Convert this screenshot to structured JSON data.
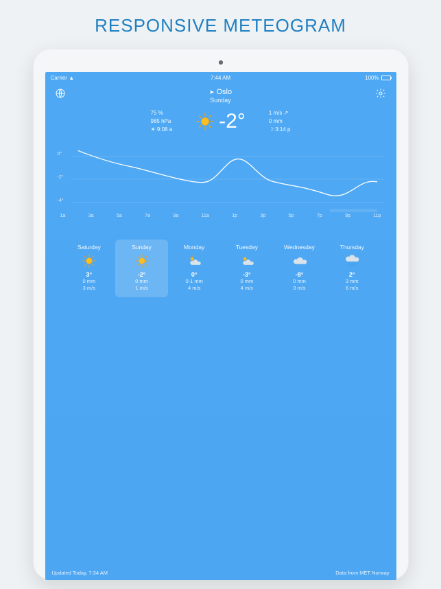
{
  "page_title": "RESPONSIVE METEOGRAM",
  "statusbar": {
    "carrier": "Carrier",
    "time": "7:44 AM",
    "battery": "100%"
  },
  "header": {
    "city": "Oslo",
    "day": "Sunday"
  },
  "current": {
    "left": {
      "humidity": "75 %",
      "pressure": "985 hPa",
      "sunrise": "☀ 9:08 a"
    },
    "temp": "-2°",
    "right": {
      "wind": "1 m/s ↗",
      "precip": "0 mm",
      "sunset": "☽ 3:14 p"
    }
  },
  "chart_data": {
    "type": "line",
    "xlabel": "",
    "ylabel": "",
    "ylim": [
      -5,
      1
    ],
    "x_ticks": [
      "1a",
      "3a",
      "5a",
      "7a",
      "9a",
      "11a",
      "1p",
      "3p",
      "5p",
      "7p",
      "9p",
      "11p"
    ],
    "y_ticks": [
      "0°",
      "-2°",
      "-4°"
    ],
    "series": [
      {
        "name": "temperature",
        "x": [
          0,
          1,
          2,
          3,
          4,
          5,
          6,
          7,
          8,
          9,
          10,
          11
        ],
        "values": [
          0.5,
          -0.5,
          -1.2,
          -1.8,
          -2.5,
          -2.5,
          -0.8,
          -2.0,
          -2.5,
          -2.8,
          -3.5,
          -2.4
        ]
      }
    ],
    "hour_icons": [
      "moon",
      "moon",
      "moon",
      "moon",
      "moon",
      "sun",
      "sun",
      "sun",
      "partly",
      "cloud",
      "cloud",
      "cloud"
    ]
  },
  "forecast": [
    {
      "day": "Saturday",
      "icon": "sun",
      "temp": "3°",
      "precip": "0 mm",
      "wind": "3 m/s",
      "selected": false
    },
    {
      "day": "Sunday",
      "icon": "sun",
      "temp": "-2°",
      "precip": "0 mm",
      "wind": "1 m/s",
      "selected": true
    },
    {
      "day": "Monday",
      "icon": "partly",
      "temp": "0°",
      "precip": "0-1 mm",
      "wind": "4 m/s",
      "selected": false
    },
    {
      "day": "Tuesday",
      "icon": "partly",
      "temp": "-3°",
      "precip": "0 mm",
      "wind": "4 m/s",
      "selected": false
    },
    {
      "day": "Wednesday",
      "icon": "cloud",
      "temp": "-8°",
      "precip": "0 mm",
      "wind": "3 m/s",
      "selected": false
    },
    {
      "day": "Thursday",
      "icon": "rain",
      "temp": "2°",
      "precip": "3 mm",
      "wind": "6 m/s",
      "selected": false
    }
  ],
  "footer": {
    "updated": "Updated Today, 7:34 AM",
    "source": "Data from MET Norway"
  }
}
